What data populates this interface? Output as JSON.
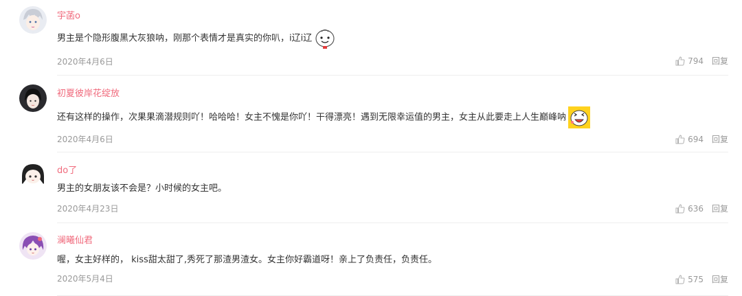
{
  "comments": [
    {
      "username": "宇菡o",
      "text": "男主是个隐形腹黑大灰狼呐，刚那个表情才是真实的你叭，i辽i辽",
      "date": "2020年4月6日",
      "likes": "794",
      "reply_label": "回复",
      "emoji": "smiley-bun-emoji",
      "avatar": "anime-boy-avatar"
    },
    {
      "username": "初夏彼岸花绽放",
      "text": "还有这样的操作，次果果滴潜规则吖！哈哈哈！女主不愧是你吖！干得漂亮！遇到无限幸运值的男主，女主从此要走上人生巅峰呐",
      "date": "2020年4月6日",
      "likes": "694",
      "reply_label": "回复",
      "emoji": "laughing-face-emoji",
      "avatar": "dark-hair-girl-avatar"
    },
    {
      "username": "do了",
      "text": "男主的女朋友该不会是？小时候的女主吧。",
      "date": "2020年4月23日",
      "likes": "636",
      "reply_label": "回复",
      "avatar": "chibi-girl-avatar"
    },
    {
      "username": "澜曦仙君",
      "text": "喔，女主好样的， kiss甜太甜了,秀死了那渣男渣女。女主你好霸道呀！亲上了负责任，负责任。",
      "date": "2020年5月4日",
      "likes": "575",
      "reply_label": "回复",
      "avatar": "purple-hair-avatar"
    }
  ],
  "colors": {
    "username": "#f06a7c",
    "text": "#333333",
    "meta": "#999999",
    "divider": "#eeeeee"
  }
}
